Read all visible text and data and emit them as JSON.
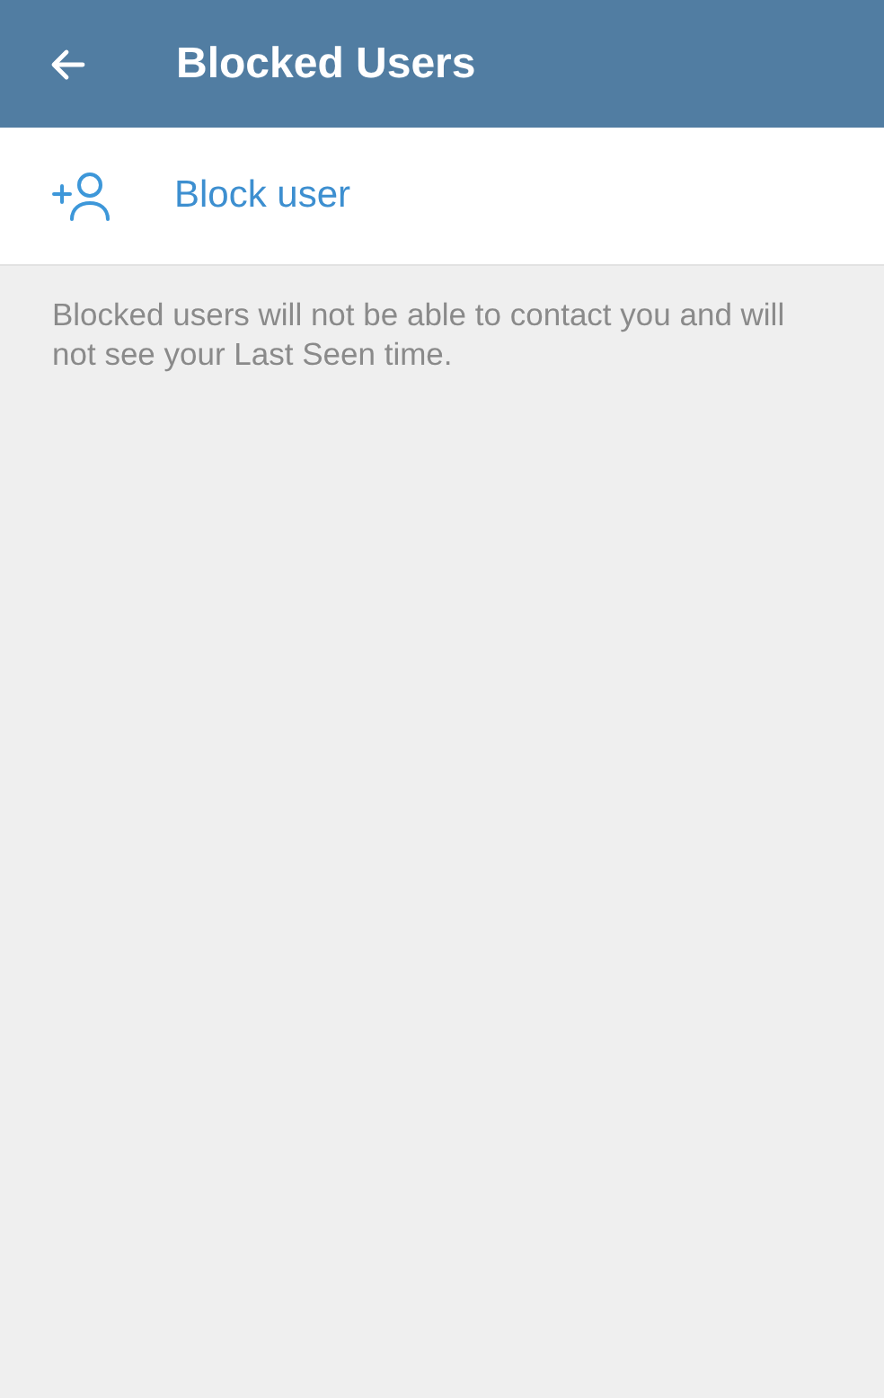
{
  "app_bar": {
    "title": "Blocked Users"
  },
  "action": {
    "label": "Block user"
  },
  "info": "Blocked users will not be able to contact you and will not see your Last Seen time."
}
